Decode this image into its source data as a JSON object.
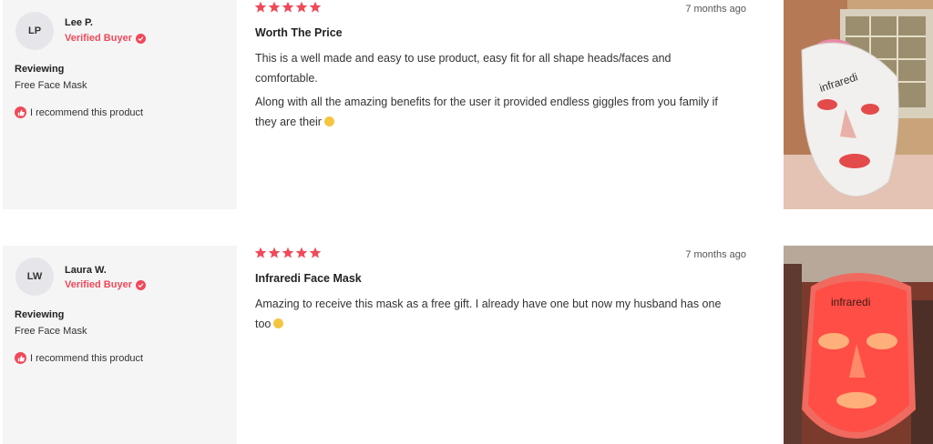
{
  "reviews": [
    {
      "initials": "LP",
      "name": "Lee P.",
      "verified_label": "Verified Buyer",
      "reviewing_label": "Reviewing",
      "product": "Free Face Mask",
      "recommend_label": "I recommend this product",
      "rating": 5,
      "date": "7 months ago",
      "title": "Worth The Price",
      "paragraphs": [
        "This is a well made and easy to use product, easy fit for all shape heads/faces and comfortable.",
        "Along with all the amazing benefits for the user it provided endless giggles from you family if they are their"
      ],
      "photo_icon": "person-wearing-white-led-mask-photo"
    },
    {
      "initials": "LW",
      "name": "Laura W.",
      "verified_label": "Verified Buyer",
      "reviewing_label": "Reviewing",
      "product": "Free Face Mask",
      "recommend_label": "I recommend this product",
      "rating": 5,
      "date": "7 months ago",
      "title": "Infraredi Face Mask",
      "paragraphs": [
        "Amazing to receive this mask as a free gift. I already have one but now my husband has one too"
      ],
      "photo_icon": "person-wearing-red-glowing-led-mask-photo"
    }
  ],
  "photo_brand_text": "infraredi",
  "colors": {
    "accent": "#ef4a5a",
    "sidebar_bg": "#f5f5f6",
    "avatar_bg": "#e6e6ea"
  }
}
